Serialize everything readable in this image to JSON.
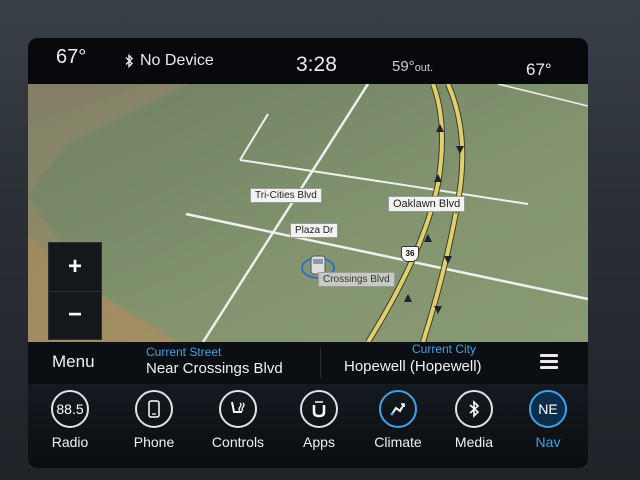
{
  "status": {
    "temp_left": "67°",
    "bluetooth_label": "No Device",
    "time": "3:28",
    "outside_temp": "59°",
    "outside_suffix": "out.",
    "temp_right": "67°"
  },
  "map": {
    "zoom_in": "+",
    "zoom_out": "−",
    "labels": {
      "tri_cities": "Tri-Cities Blvd",
      "plaza": "Plaza Dr",
      "oaklawn": "Oaklawn Blvd",
      "crossings": "Crossings Blvd",
      "route_shield": "36"
    }
  },
  "info": {
    "menu": "Menu",
    "current_street_label": "Current Street",
    "current_street": "Near Crossings Blvd",
    "current_city_label": "Current City",
    "current_city": "Hopewell (Hopewell)"
  },
  "dock": {
    "radio": {
      "label": "Radio",
      "icon_text": "88.5"
    },
    "phone": {
      "label": "Phone"
    },
    "controls": {
      "label": "Controls"
    },
    "apps": {
      "label": "Apps"
    },
    "climate": {
      "label": "Climate"
    },
    "media": {
      "label": "Media"
    },
    "nav": {
      "label": "Nav",
      "icon_text": "NE"
    }
  },
  "colors": {
    "accent": "#3fa3e8",
    "map_ground": "#7e8e6c",
    "highway": "#e1d06a"
  }
}
